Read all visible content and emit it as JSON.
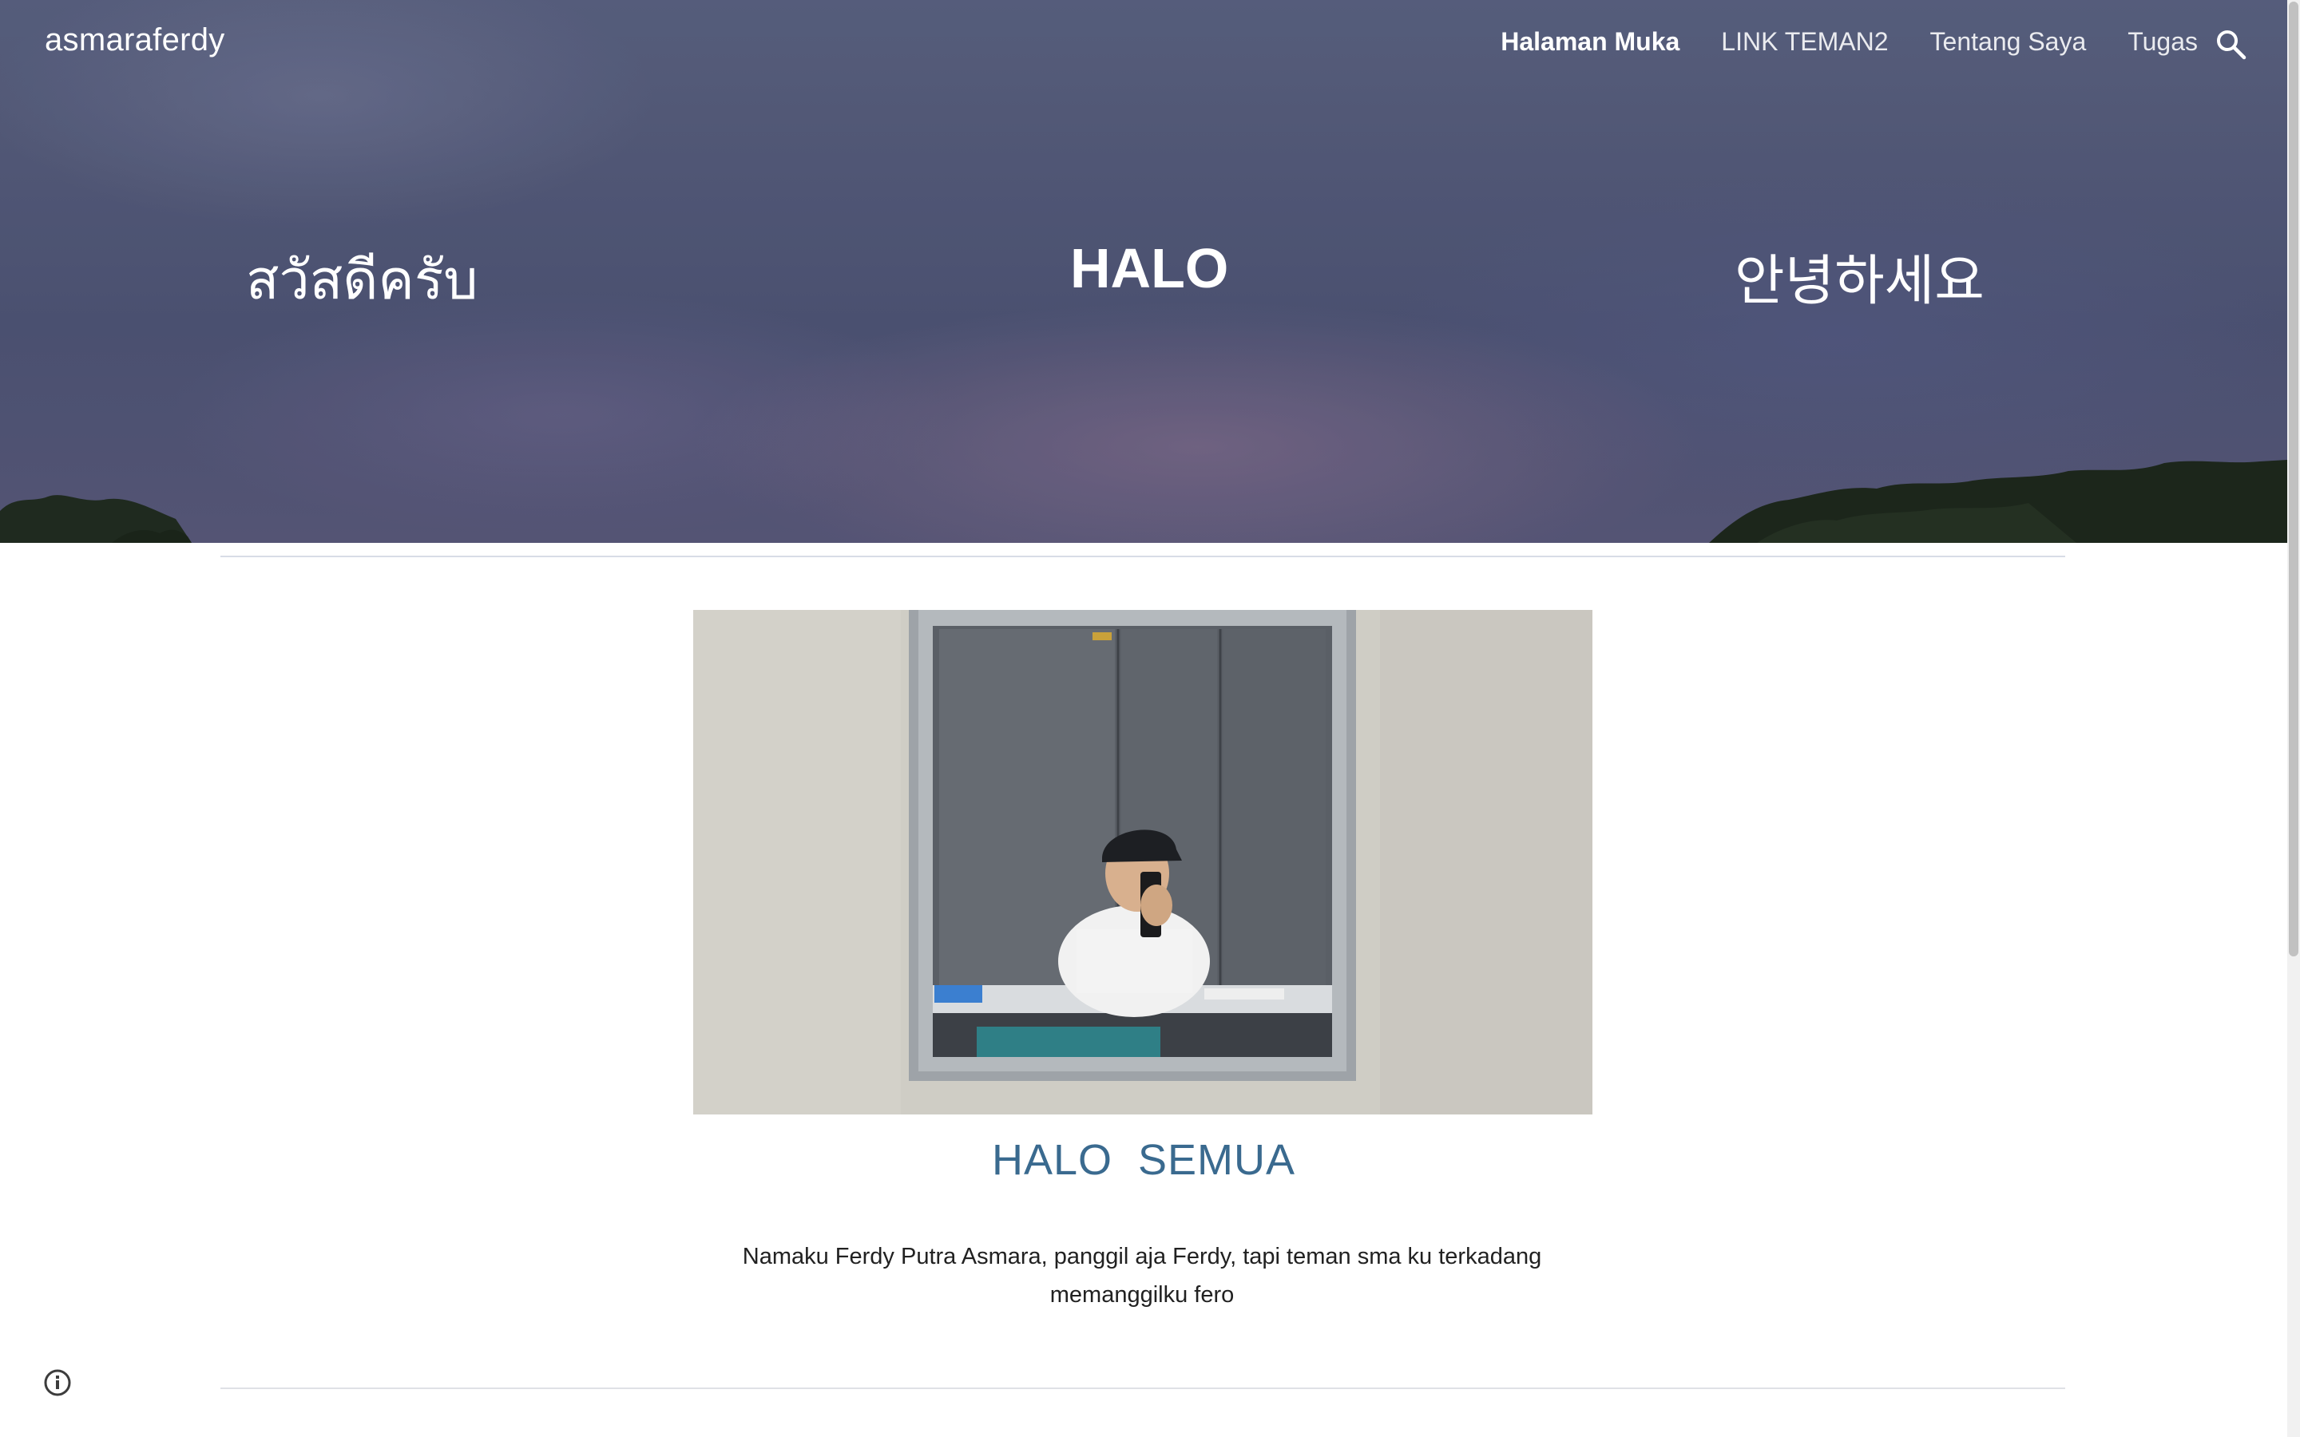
{
  "header": {
    "site_title": "asmaraferdy",
    "nav": [
      {
        "label": "Halaman Muka",
        "active": true
      },
      {
        "label": "LINK TEMAN2",
        "active": false
      },
      {
        "label": "Tentang Saya",
        "active": false
      },
      {
        "label": "Tugas",
        "active": false
      }
    ],
    "search_icon": "search-icon"
  },
  "hero": {
    "greetings": {
      "thai": "สวัสดีครับ",
      "halo": "HALO",
      "korean": "안녕하세요"
    }
  },
  "main": {
    "photo_description": "",
    "heading": "HALO  SEMUA",
    "intro": "Namaku Ferdy Putra Asmara, panggil aja Ferdy, tapi teman sma ku terkadang memanggilku fero"
  },
  "footer": {
    "info_icon": "info-icon"
  },
  "colors": {
    "heading": "#3a6a8f",
    "hero_overlay": "#555c7a",
    "nav_text": "#ffffff"
  }
}
